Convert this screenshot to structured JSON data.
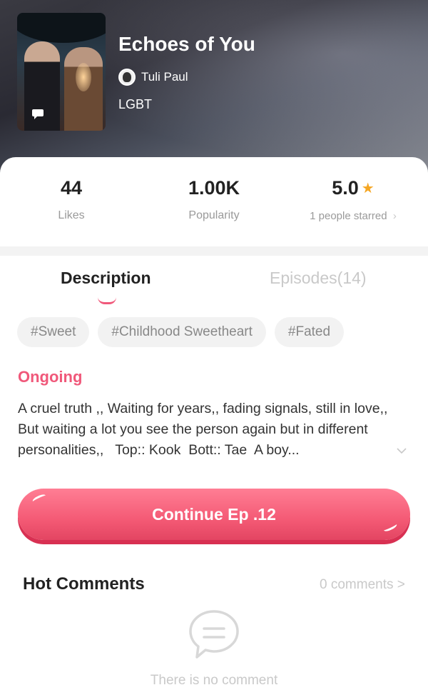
{
  "book": {
    "title": "Echoes of You",
    "author": "Tuli Paul",
    "genre": "LGBT"
  },
  "stats": {
    "likes_value": "44",
    "likes_label": "Likes",
    "popularity_value": "1.00K",
    "popularity_label": "Popularity",
    "rating_value": "5.0",
    "rating_label": "1 people starred",
    "rating_chevron": "›"
  },
  "tabs": {
    "description": "Description",
    "episodes": "Episodes(14)"
  },
  "tags": [
    "#Sweet",
    "#Childhood Sweetheart",
    "#Fated"
  ],
  "status": "Ongoing",
  "description": "A cruel truth ,, Waiting for years,, fading signals, still in love,, But waiting a lot you see the person again but in different personalities,,   Top:: Kook  Bott:: Tae  A boy...",
  "expand_icon": "chevron-down-icon",
  "cta": {
    "label": "Continue Ep .12"
  },
  "comments": {
    "heading": "Hot Comments",
    "count_label": "0 comments >",
    "empty_text": "There is no comment"
  },
  "colors": {
    "accent": "#f0587a",
    "star": "#f5a623",
    "muted": "#c9c9c9"
  }
}
